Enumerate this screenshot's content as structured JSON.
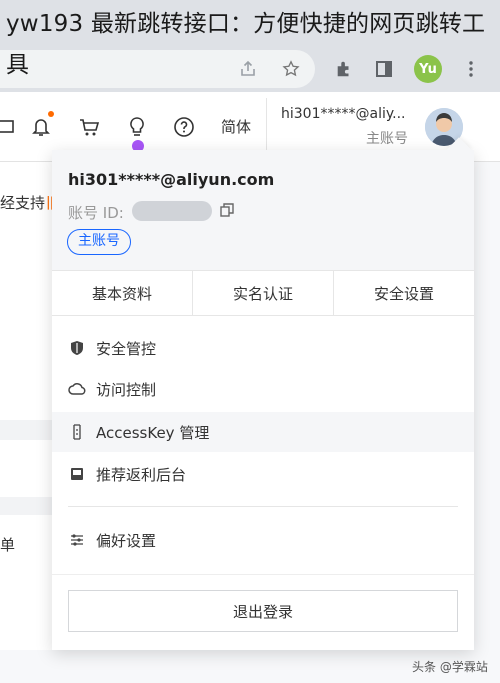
{
  "headline": "yw193 最新跳转接口：方便快捷的网页跳转工具",
  "browser": {
    "profile_initials": "Yu",
    "icons": [
      "share-icon",
      "star-icon",
      "extensions-icon",
      "sidebar-icon",
      "more-icon"
    ]
  },
  "topbar": {
    "language_label": "简体",
    "account_name": "hi301*****@aliy...",
    "account_role": "主账号",
    "icons": [
      "screen-icon",
      "bell-icon",
      "cart-icon",
      "bulb-icon",
      "help-icon"
    ]
  },
  "background": {
    "left_text_1": "经支持",
    "left_orange_mark": "旧",
    "left_text_2": "单"
  },
  "dropdown": {
    "email": "hi301*****@aliyun.com",
    "account_id_label": "账号 ID:",
    "role_badge": "主账号",
    "tabs": [
      "基本资料",
      "实名认证",
      "安全设置"
    ],
    "menu": [
      {
        "label": "安全管控",
        "icon": "shield-icon"
      },
      {
        "label": "访问控制",
        "icon": "cloud-icon"
      },
      {
        "label": "AccessKey 管理",
        "icon": "key-icon"
      },
      {
        "label": "推荐返利后台",
        "icon": "gift-icon"
      },
      {
        "label": "偏好设置",
        "icon": "sliders-icon"
      }
    ],
    "logout_label": "退出登录"
  },
  "watermark": "头条 @学霖站",
  "colors": {
    "accent": "#1966ff",
    "notification": "#ff6a00",
    "highlight": "#a855f7",
    "profile": "#8bc34a"
  }
}
